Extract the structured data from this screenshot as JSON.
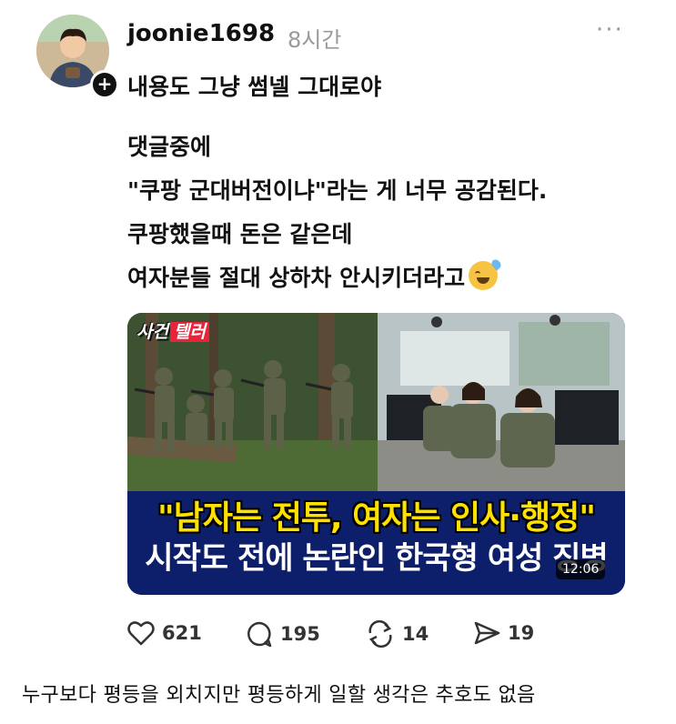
{
  "post": {
    "username": "joonie1698",
    "time": "8시간",
    "first_line": "내용도 그냥 썸넬 그대로야",
    "body_lines": [
      "댓글중에",
      "\"쿠팡 군대버전이냐\"라는 게 너무 공감된다.",
      "쿠팡했을때 돈은 같은데",
      "여자분들 절대 상하차 안시키더라고"
    ],
    "emoji": "grinning-face-with-sweat"
  },
  "thumbnail": {
    "logo_part1": "사건",
    "logo_part2": "텔러",
    "headline1": "\"남자는 전투, 여자는 인사·행정\"",
    "headline2": "시작도 전에 논란인 한국형 여성 징병",
    "duration": "12:06"
  },
  "actions": {
    "likes": "621",
    "comments": "195",
    "reposts": "14",
    "shares": "19"
  },
  "caption": "누구보다 평등을 외치지만 평등하게 일할 생각은 추호도 없음",
  "colors": {
    "headline_yellow": "#ffe100",
    "headline_band": "#0d1f6a",
    "logo_red": "#e8233a"
  }
}
